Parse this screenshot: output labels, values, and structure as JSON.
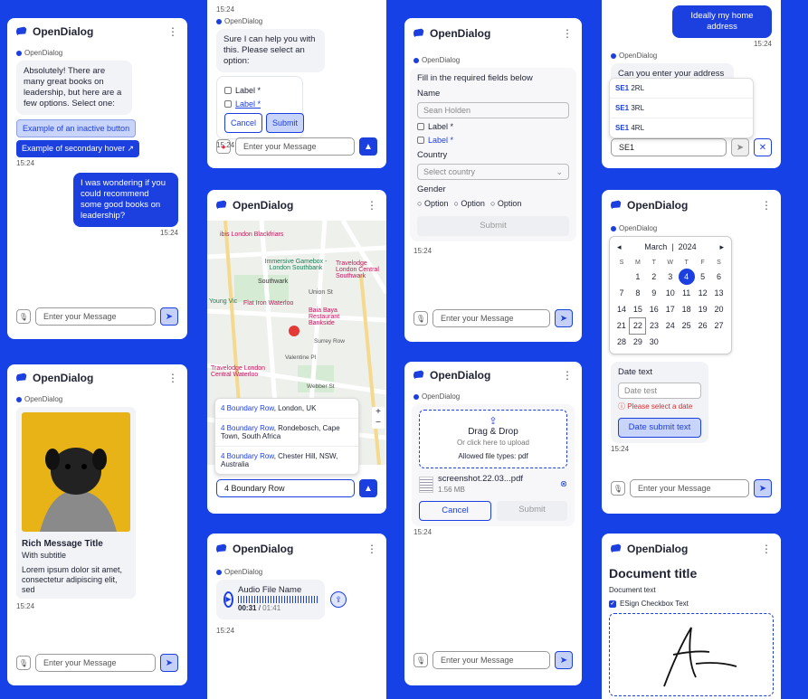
{
  "brand": "OpenDialog",
  "menu_glyph": "⋮",
  "from_label": "OpenDialog",
  "input_placeholder": "Enter your Message",
  "c1": {
    "bot_text": "Absolutely! There are many great books on leadership, but here are a few options. Select one:",
    "btn_inactive": "Example of an inactive button",
    "btn_hover": "Example of secondary hover ↗",
    "ts1": "15:24",
    "user_text": "I was wondering if you could recommend some good books on leadership?",
    "ts2": "15:24"
  },
  "c2": {
    "ts_top": "15:24",
    "bot_text": "Sure I can help you with this. Please select an option:",
    "opt1": "Label *",
    "opt2": "Label *",
    "cancel": "Cancel",
    "submit": "Submit",
    "ts": "15:24"
  },
  "c3": {
    "prompt": "Fill in the required fields below",
    "name_label": "Name",
    "name_value": "Sean Holden",
    "opt1": "Label *",
    "opt2": "Label *",
    "country_label": "Country",
    "country_placeholder": "Select country",
    "gender_label": "Gender",
    "g1": "Option",
    "g2": "Option",
    "g3": "Option",
    "submit": "Submit",
    "ts": "15:24"
  },
  "c4": {
    "user_text": "Ideally my home address",
    "ts": "15:24",
    "bot_text": "Can you enter your address for me please?",
    "suggestions": [
      {
        "bold": "SE1",
        "rest": " 2RL"
      },
      {
        "bold": "SE1",
        "rest": " 3RL"
      },
      {
        "bold": "SE1",
        "rest": " 4RL"
      }
    ],
    "input_value": "SE1"
  },
  "c5": {
    "map_labels": [
      "ibis London Blackfriars",
      "Immersive Gamebox - London Southbank",
      "Travelodge London Central Southwark",
      "Southwark",
      "Union St",
      "Young Vic",
      "Flat Iron Waterloo",
      "Baia Baya Restaurant Bankside",
      "Surrey Row",
      "Valentine Pl",
      "Travelodge London Central Waterloo",
      "Webber St"
    ],
    "results": [
      {
        "bold": "4 Boundary Row",
        "rest": ", London, UK"
      },
      {
        "bold": "4 Boundary Row",
        "rest": ", Rondebosch, Cape Town, South Africa"
      },
      {
        "bold": "4 Boundary Row",
        "rest": ", Chester Hill, NSW, Australia"
      }
    ],
    "input_value": "4 Boundary Row"
  },
  "c6": {
    "month": "March",
    "year": "2024",
    "days": [
      "S",
      "M",
      "T",
      "W",
      "T",
      "F",
      "S"
    ],
    "weeks": [
      [
        "",
        "1",
        "2",
        "3",
        "4",
        "5",
        "6"
      ],
      [
        "7",
        "8",
        "9",
        "10",
        "11",
        "12",
        "13"
      ],
      [
        "14",
        "15",
        "16",
        "17",
        "18",
        "19",
        "20"
      ],
      [
        "21",
        "22",
        "23",
        "24",
        "25",
        "26",
        "27"
      ],
      [
        "28",
        "29",
        "30",
        "",
        "",
        "",
        ""
      ]
    ],
    "date_label": "Date text",
    "date_placeholder": "Date test",
    "error": "Please select a date",
    "submit": "Date submit text",
    "ts": "15:24"
  },
  "c7": {
    "title": "Rich Message Title",
    "subtitle": "With subtitle",
    "body": "Lorem ipsum dolor sit amet, consectetur adipiscing elit, sed",
    "ts": "15:24"
  },
  "c8": {
    "file_name": "Audio File Name",
    "current": "00:31",
    "total": "01:41",
    "ts": "15:24"
  },
  "c9": {
    "drag": "Drag & Drop",
    "click": "Or click here to upload",
    "allowed": "Allowed file types: pdf",
    "file": "screenshot.22.03...pdf",
    "size": "1.56 MB",
    "cancel": "Cancel",
    "submit": "Submit",
    "ts": "15:24"
  },
  "c10": {
    "title": "Document title",
    "text": "Document text",
    "checkbox": "ESign Checkbox Text"
  }
}
